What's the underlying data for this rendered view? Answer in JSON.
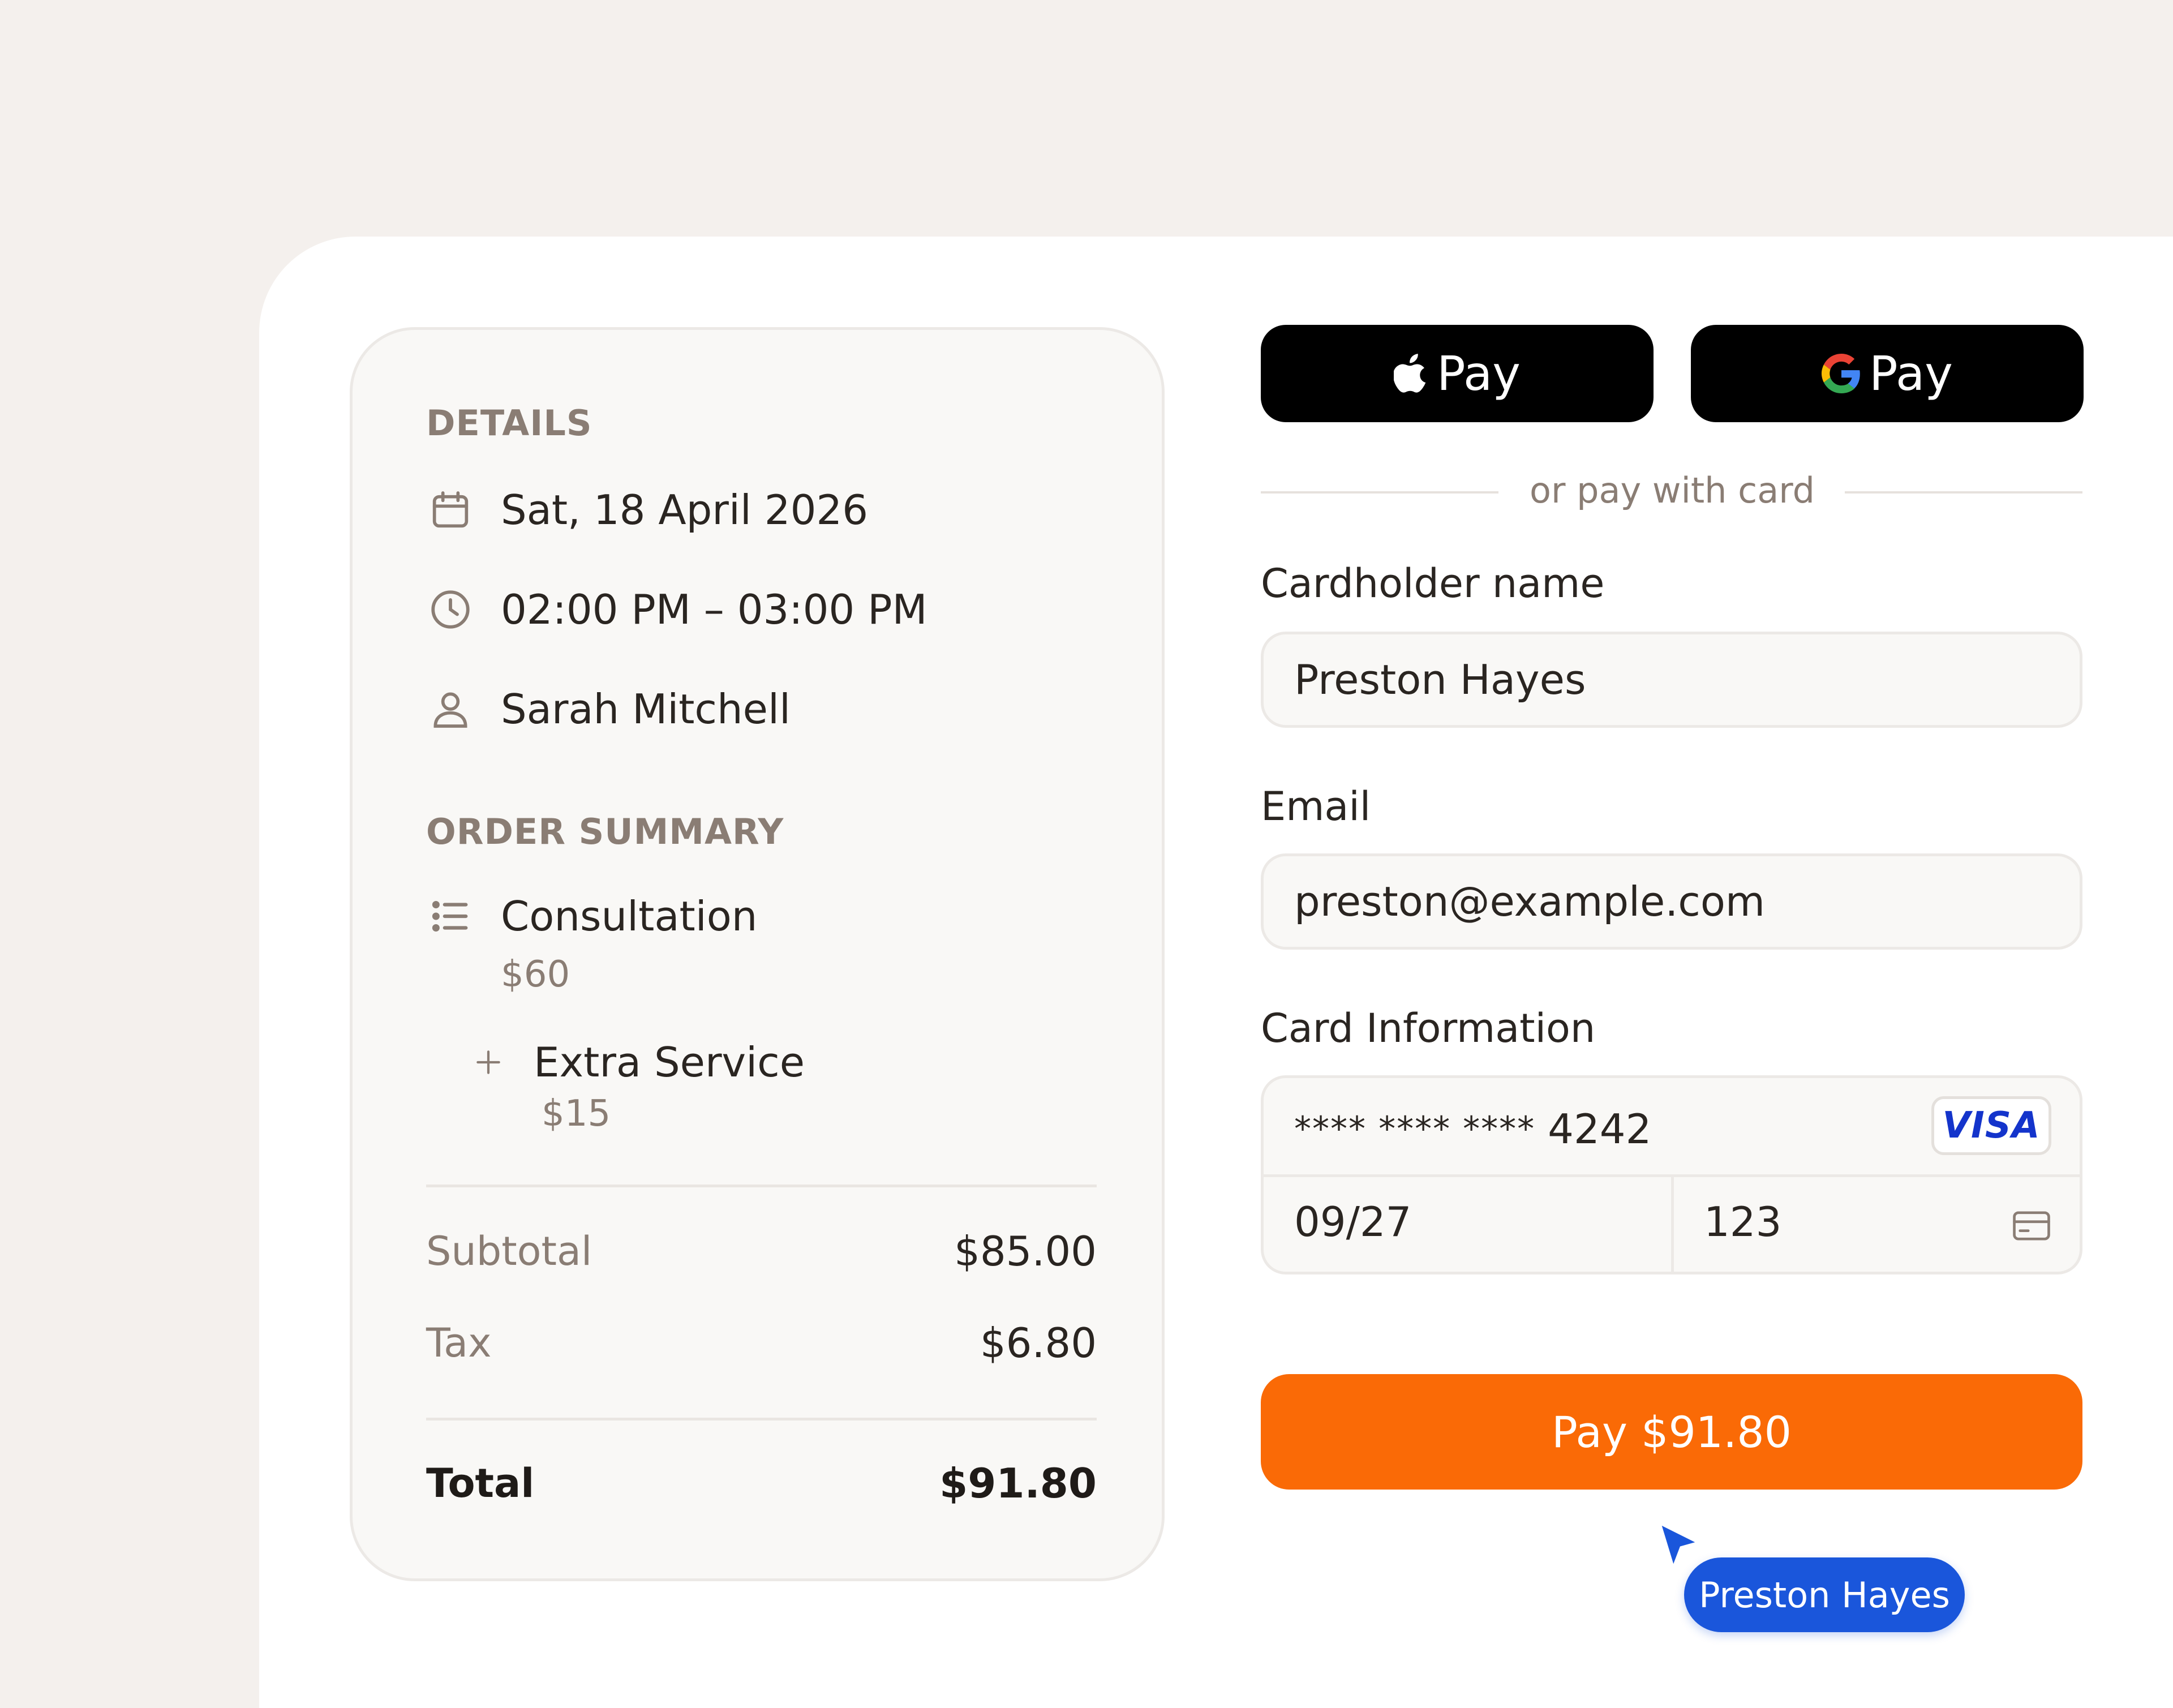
{
  "details": {
    "heading": "DETAILS",
    "date": "Sat, 18 April 2026",
    "time": "02:00 PM – 03:00 PM",
    "person": "Sarah Mitchell"
  },
  "order_summary": {
    "heading": "ORDER SUMMARY",
    "items": [
      {
        "name": "Consultation",
        "price": "$60"
      },
      {
        "name": "Extra Service",
        "price": "$15"
      }
    ],
    "subtotal_label": "Subtotal",
    "subtotal_value": "$85.00",
    "tax_label": "Tax",
    "tax_value": "$6.80",
    "total_label": "Total",
    "total_value": "$91.80"
  },
  "wallets": {
    "apple_label": "Pay",
    "google_label": "Pay"
  },
  "separator_text": "or pay with card",
  "form": {
    "cardholder_label": "Cardholder name",
    "cardholder_value": "Preston Hayes",
    "email_label": "Email",
    "email_value": "preston@example.com",
    "card_label": "Card Information",
    "card_mask": "**** **** ****",
    "card_last4": "4242",
    "card_brand": "VISA",
    "expiry": "09/27",
    "cvc": "123"
  },
  "pay_button_label": "Pay $91.80",
  "cursor_tooltip": "Preston Hayes",
  "colors": {
    "accent": "#fa6a06",
    "cursor": "#1a56db",
    "muted": "#8a7d74"
  },
  "icons": [
    "calendar-icon",
    "clock-icon",
    "user-icon",
    "list-icon",
    "plus-icon",
    "apple-logo-icon",
    "google-logo-icon",
    "visa-logo",
    "card-icon",
    "pointer-cursor-icon"
  ]
}
